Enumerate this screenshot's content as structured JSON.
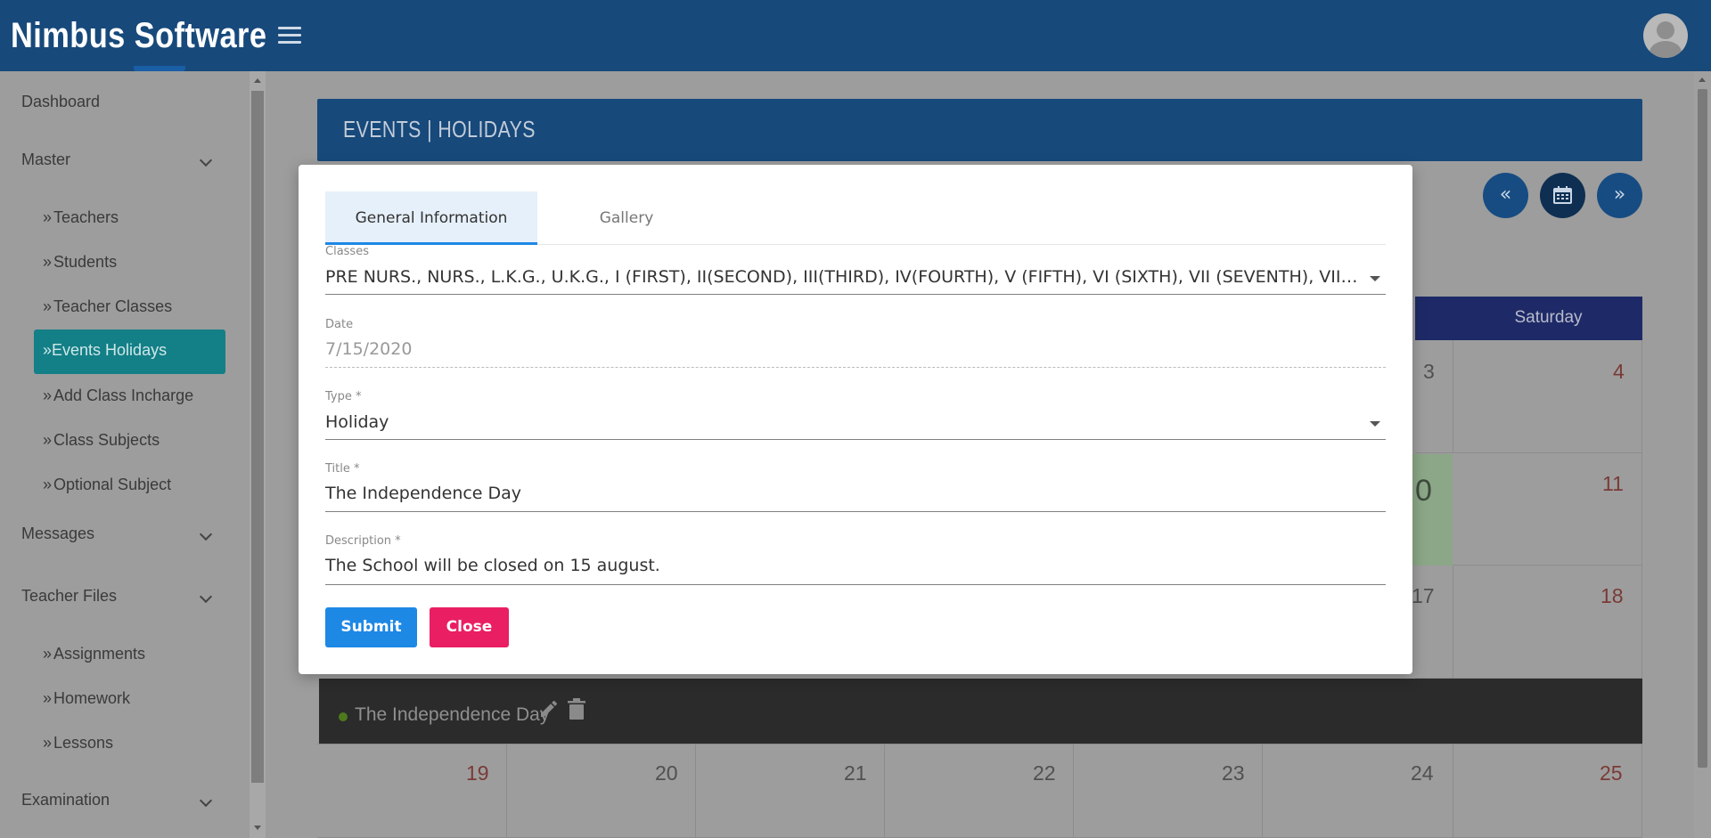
{
  "app": {
    "brand": "Nimbus Software"
  },
  "sidebar": {
    "items": [
      {
        "label": "Dashboard"
      },
      {
        "label": "Master"
      },
      {
        "label": "Messages"
      },
      {
        "label": "Teacher Files"
      },
      {
        "label": "Examination"
      }
    ],
    "master_sub": [
      {
        "label": "Teachers"
      },
      {
        "label": "Students"
      },
      {
        "label": "Teacher Classes"
      },
      {
        "label": "Events Holidays"
      },
      {
        "label": "Add Class Incharge"
      },
      {
        "label": "Class Subjects"
      },
      {
        "label": "Optional Subject"
      }
    ],
    "files_sub": [
      {
        "label": "Assignments"
      },
      {
        "label": "Homework"
      },
      {
        "label": "Lessons"
      }
    ],
    "sub_marker": "»"
  },
  "page": {
    "title": "EVENTS | HOLIDAYS",
    "nav": {
      "prev": "«",
      "next": "»"
    }
  },
  "calendar": {
    "weekday_visible": "Saturday",
    "days": [
      "3",
      "4",
      "0",
      "11",
      "17",
      "18",
      "19",
      "20",
      "21",
      "22",
      "23",
      "24",
      "25"
    ],
    "event": {
      "title": "The Independence Day",
      "dot_color": "#76c21a"
    }
  },
  "modal": {
    "tabs": [
      {
        "label": "General Information",
        "active": true
      },
      {
        "label": "Gallery",
        "active": false
      }
    ],
    "fields": {
      "classes": {
        "label": "Classes",
        "value": "PRE NURS., NURS., L.K.G., U.K.G., I (FIRST), II(SECOND), III(THIRD), IV(FOURTH), V (FIFTH), VI (SIXTH), VII (SEVENTH), VIII (EIGHT), IX (NINTH), X (TENTH)"
      },
      "date": {
        "label": "Date",
        "value": "7/15/2020"
      },
      "type": {
        "label": "Type *",
        "value": "Holiday"
      },
      "title": {
        "label": "Title *",
        "value": "The Independence Day"
      },
      "description": {
        "label": "Description *",
        "value": "The School will be closed on 15 august."
      }
    },
    "buttons": {
      "submit": "Submit",
      "close": "Close"
    }
  },
  "colors": {
    "header": "#1a5fa5",
    "submit": "#1e88e5",
    "close": "#e91e63",
    "active_sidebar": "#17a2b8"
  }
}
